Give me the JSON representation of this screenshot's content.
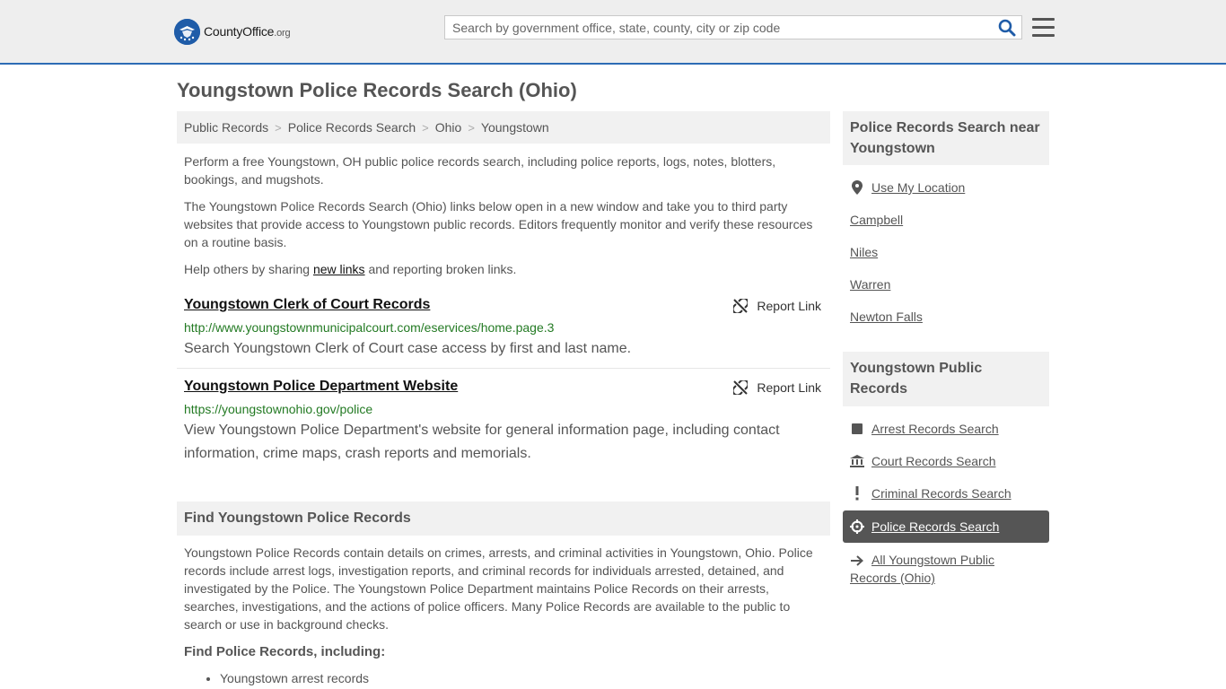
{
  "brand": {
    "name_main": "CountyOffice",
    "name_suffix": ".org",
    "accent_color": "#2d6cb5",
    "logo_color": "#1f5ca8"
  },
  "header": {
    "search_placeholder": "Search by government office, state, county, city or zip code",
    "search_icon": "search-icon",
    "menu_icon": "hamburger-menu-icon"
  },
  "page": {
    "title": "Youngstown Police Records Search (Ohio)"
  },
  "breadcrumb": [
    "Public Records",
    "Police Records Search",
    "Ohio",
    "Youngstown"
  ],
  "breadcrumb_separator": ">",
  "intro": {
    "p1": "Perform a free Youngstown, OH public police records search, including police reports, logs, notes, blotters, bookings, and mugshots.",
    "p2": "The Youngstown Police Records Search (Ohio) links below open in a new window and take you to third party websites that provide access to Youngstown public records. Editors frequently monitor and verify these resources on a routine basis.",
    "p3_before": "Help others by sharing ",
    "p3_link": "new links",
    "p3_after": " and reporting broken links."
  },
  "results": [
    {
      "title": "Youngstown Clerk of Court Records",
      "url": "http://www.youngstownmunicipalcourt.com/eservices/home.page.3",
      "description": "Search Youngstown Clerk of Court case access by first and last name.",
      "report_label": "Report Link"
    },
    {
      "title": "Youngstown Police Department Website",
      "url": "https://youngstownohio.gov/police",
      "description": "View Youngstown Police Department's website for general information page, including contact information, crime maps, crash reports and memorials.",
      "report_label": "Report Link"
    }
  ],
  "find_section": {
    "heading": "Find Youngstown Police Records",
    "body": "Youngstown Police Records contain details on crimes, arrests, and criminal activities in Youngstown, Ohio. Police records include arrest logs, investigation reports, and criminal records for individuals arrested, detained, and investigated by the Police. The Youngstown Police Department maintains Police Records on their arrests, searches, investigations, and the actions of police officers. Many Police Records are available to the public to search or use in background checks.",
    "subheading": "Find Police Records, including:",
    "bullets": [
      "Youngstown arrest records"
    ]
  },
  "sidebar": {
    "nearby_heading": "Police Records Search near Youngstown",
    "use_location": "Use My Location",
    "nearby": [
      "Campbell",
      "Niles",
      "Warren",
      "Newton Falls"
    ],
    "public_heading": "Youngstown Public Records",
    "public_links": [
      {
        "label": "Arrest Records Search",
        "icon": "square-icon"
      },
      {
        "label": "Court Records Search",
        "icon": "courthouse-icon"
      },
      {
        "label": "Criminal Records Search",
        "icon": "exclamation-icon"
      },
      {
        "label": "Police Records Search",
        "icon": "crosshairs-icon",
        "active": true
      },
      {
        "label": "All Youngstown Public Records (Ohio)",
        "icon": "arrow-right-icon"
      }
    ]
  }
}
